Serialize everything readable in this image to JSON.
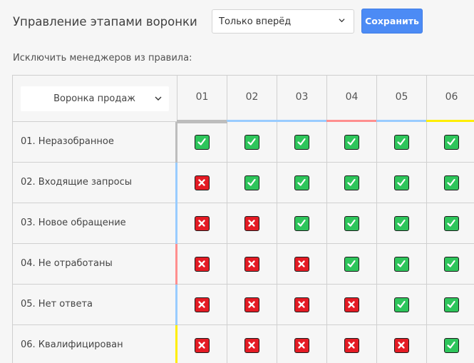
{
  "header": {
    "title": "Управление этапами воронки",
    "mode_select": {
      "value": "Только вперёд",
      "icon": "chevron-down-icon"
    },
    "save_label": "Сохранить"
  },
  "subtitle": "Исключить менеджеров из правила:",
  "colors": {
    "accent": "#4c8bf5",
    "check": "#2ec55b",
    "cross": "#e41b24",
    "stage_01": "#bdbdbd",
    "stage_02": "#99ccff",
    "stage_03": "#99ccff",
    "stage_04": "#ff8f8f",
    "stage_05": "#99ccff",
    "stage_06": "#ffee00"
  },
  "matrix": {
    "funnel_select": {
      "value": "Воронка продаж",
      "icon": "chevron-down-icon"
    },
    "columns": [
      {
        "label": "01",
        "color": "#bdbdbd"
      },
      {
        "label": "02",
        "color": "#99ccff"
      },
      {
        "label": "03",
        "color": "#99ccff"
      },
      {
        "label": "04",
        "color": "#ff8f8f"
      },
      {
        "label": "05",
        "color": "#99ccff"
      },
      {
        "label": "06",
        "color": "#ffee00"
      }
    ],
    "rows": [
      {
        "label": "01. Неразобранное",
        "color": "#bdbdbd",
        "cells": [
          "check",
          "check",
          "check",
          "check",
          "check",
          "check"
        ]
      },
      {
        "label": "02. Входящие запросы",
        "color": "#99ccff",
        "cells": [
          "cross",
          "check",
          "check",
          "check",
          "check",
          "check"
        ]
      },
      {
        "label": "03. Новое обращение",
        "color": "#99ccff",
        "cells": [
          "cross",
          "cross",
          "check",
          "check",
          "check",
          "check"
        ]
      },
      {
        "label": "04. Не отработаны",
        "color": "#ff8f8f",
        "cells": [
          "cross",
          "cross",
          "cross",
          "check",
          "check",
          "check"
        ]
      },
      {
        "label": "05. Нет ответа",
        "color": "#99ccff",
        "cells": [
          "cross",
          "cross",
          "cross",
          "cross",
          "check",
          "check"
        ]
      },
      {
        "label": "06. Квалифицирован",
        "color": "#ffee00",
        "cells": [
          "cross",
          "cross",
          "cross",
          "cross",
          "cross",
          "check"
        ]
      }
    ]
  }
}
